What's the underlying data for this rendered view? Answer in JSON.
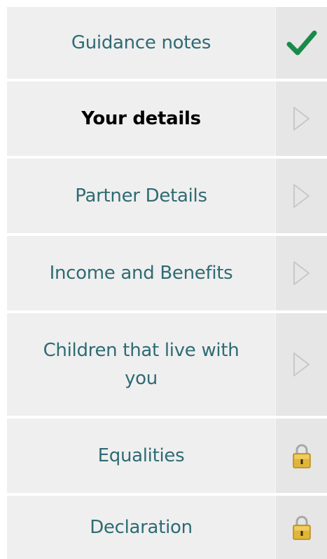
{
  "nav": {
    "items": [
      {
        "label": "Guidance notes",
        "status_icon": "checkmark-icon",
        "state": "complete"
      },
      {
        "label": "Your details",
        "status_icon": "play-arrow-icon",
        "state": "current"
      },
      {
        "label": "Partner Details",
        "status_icon": "play-arrow-icon",
        "state": "available"
      },
      {
        "label": "Income and Benefits",
        "status_icon": "play-arrow-icon",
        "state": "available"
      },
      {
        "label": "Children that live with you",
        "status_icon": "play-arrow-icon",
        "state": "available"
      },
      {
        "label": "Equalities",
        "status_icon": "padlock-icon",
        "state": "locked"
      },
      {
        "label": "Declaration",
        "status_icon": "padlock-icon",
        "state": "locked"
      }
    ]
  },
  "colors": {
    "label_text": "#2f6b73",
    "active_label_text": "#000000",
    "checkmark": "#1a8a4a",
    "arrow_outline": "#c8c8c8",
    "lock_body": "#e0b63a",
    "row_background": "#efefef",
    "icon_cell_background": "#e6e6e6"
  }
}
